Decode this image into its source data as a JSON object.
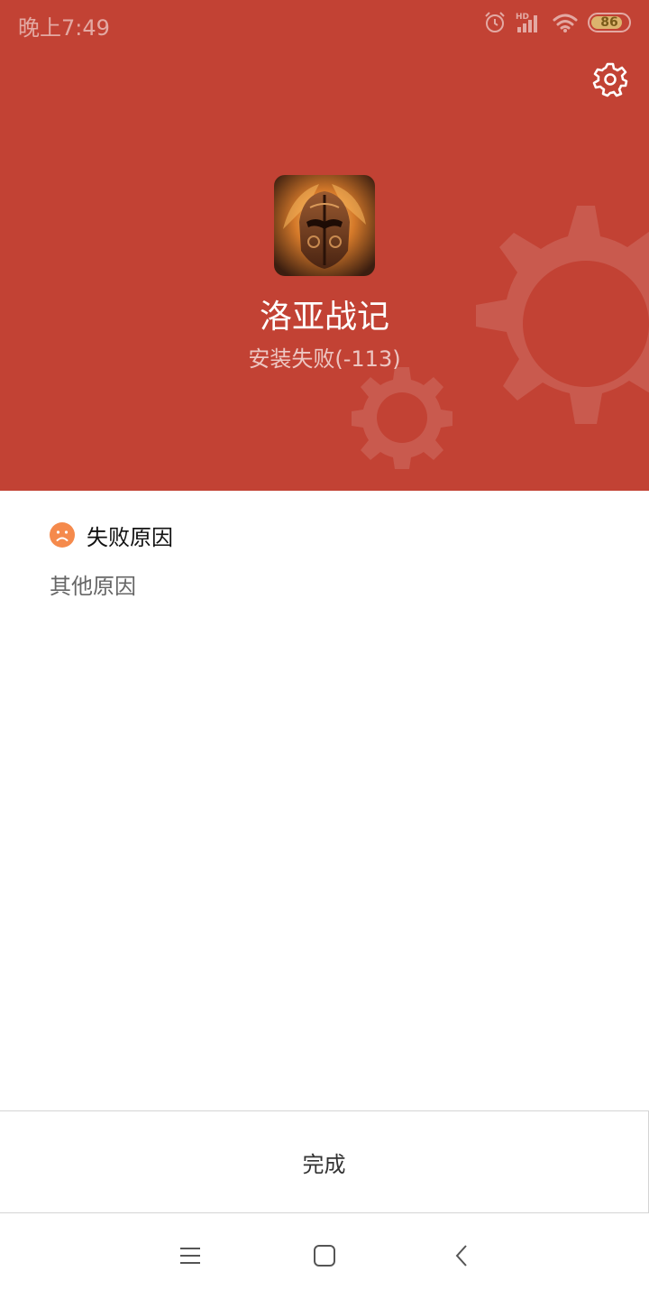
{
  "status_bar": {
    "time": "晚上7:49",
    "icons": [
      "alarm-icon",
      "hd-signal-icon",
      "wifi-icon",
      "battery-icon"
    ],
    "hd_label": "HD",
    "battery_level": "86"
  },
  "header": {
    "background_color": "#c24234",
    "settings_icon": "gear-icon",
    "app_name": "洛亚战记",
    "install_status": "安装失败(-113)"
  },
  "failure": {
    "icon": "sad-face-icon",
    "icon_color": "#f58a4c",
    "title": "失败原因",
    "reason": "其他原因"
  },
  "actions": {
    "done_label": "完成"
  },
  "nav_bar": {
    "buttons": [
      "menu-icon",
      "home-icon",
      "back-icon"
    ]
  }
}
